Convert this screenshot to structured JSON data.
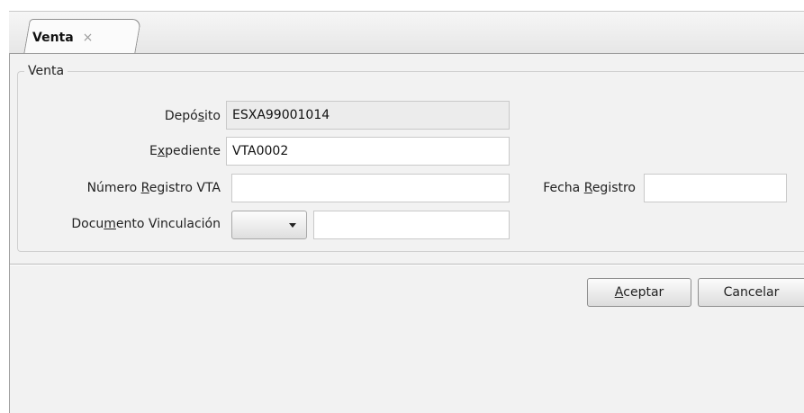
{
  "tab": {
    "label": "Venta",
    "close_glyph": "×"
  },
  "group": {
    "legend": "Venta"
  },
  "form": {
    "deposito": {
      "label_pre": "Depó",
      "label_key": "s",
      "label_post": "ito",
      "value": "ESXA99001014"
    },
    "expediente": {
      "label_pre": "E",
      "label_key": "x",
      "label_post": "pediente",
      "value": "VTA0002"
    },
    "numero_registro": {
      "label_pre": "Número ",
      "label_key": "R",
      "label_post": "egistro VTA",
      "value": ""
    },
    "fecha_registro": {
      "label_pre": "Fecha ",
      "label_key": "R",
      "label_post": "egistro",
      "value": ""
    },
    "documento_vinculacion": {
      "label_pre": "Docu",
      "label_key": "m",
      "label_post": "ento Vinculación",
      "select_value": "",
      "value": ""
    }
  },
  "buttons": {
    "accept": {
      "label_key": "A",
      "label_rest": "ceptar"
    },
    "cancel": {
      "label": "Cancelar"
    }
  },
  "icons": {
    "combo_arrow": "chevron-down-icon",
    "tab_close": "close-icon"
  }
}
